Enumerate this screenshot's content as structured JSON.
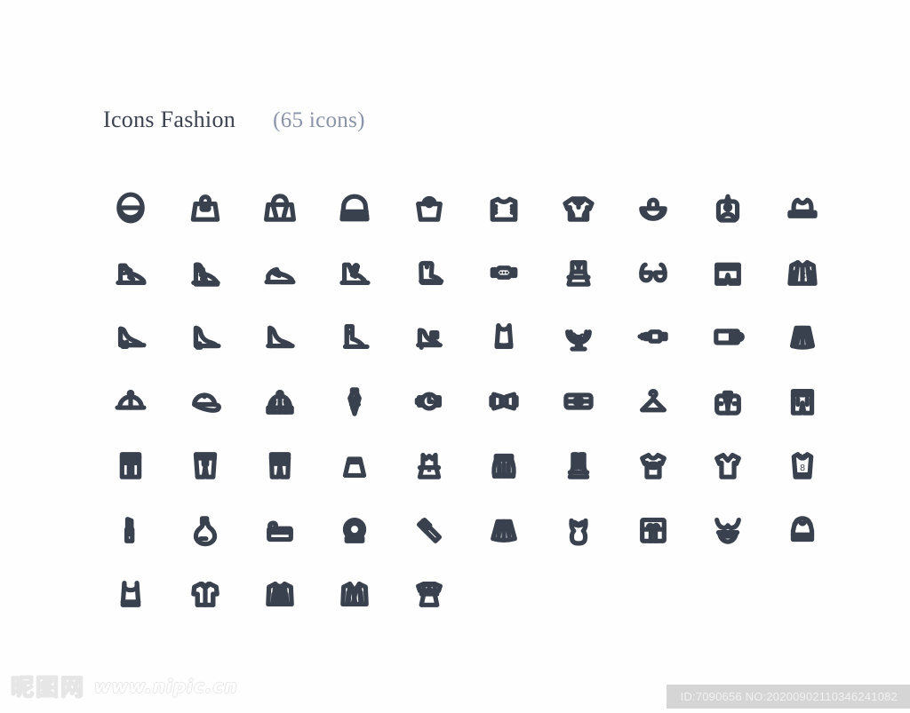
{
  "page": {
    "background_color": "#fefefe",
    "icon_color": "#3a414e",
    "title_color": "#3c4250",
    "count_color": "#8a93a8"
  },
  "header": {
    "title": "Icons Fashion",
    "count_label": "(65 icons)"
  },
  "grid": {
    "columns": 10,
    "rows": 7,
    "total_icons": 65,
    "icons": [
      {
        "name": "coin-purse-icon",
        "label": "Coin purse"
      },
      {
        "name": "handbag-icon",
        "label": "Handbag"
      },
      {
        "name": "tote-bag-icon",
        "label": "Tote bag"
      },
      {
        "name": "doctor-bag-icon",
        "label": "Doctor bag"
      },
      {
        "name": "shopping-bag-icon",
        "label": "Shopping bag"
      },
      {
        "name": "sweater-icon",
        "label": "Sweater"
      },
      {
        "name": "hoodie-icon",
        "label": "Hoodie"
      },
      {
        "name": "bonnet-hat-icon",
        "label": "Bonnet hat"
      },
      {
        "name": "backpack-small-icon",
        "label": "Backpack"
      },
      {
        "name": "fedora-hat-icon",
        "label": "Fedora hat"
      },
      {
        "name": "sneaker-icon",
        "label": "Sneaker"
      },
      {
        "name": "high-top-shoe-icon",
        "label": "High-top shoe"
      },
      {
        "name": "running-shoe-icon",
        "label": "Running shoe"
      },
      {
        "name": "hiking-boot-icon",
        "label": "Hiking boot"
      },
      {
        "name": "rain-boot-icon",
        "label": "Rain boot"
      },
      {
        "name": "wristwatch-dots-icon",
        "label": "Wristwatch"
      },
      {
        "name": "pinafore-dress-icon",
        "label": "Pinafore dress"
      },
      {
        "name": "eyeglasses-icon",
        "label": "Eyeglasses"
      },
      {
        "name": "sport-shorts-icon",
        "label": "Sport shorts"
      },
      {
        "name": "blazer-jacket-icon",
        "label": "Blazer jacket"
      },
      {
        "name": "high-heel-icon",
        "label": "High heel"
      },
      {
        "name": "stiletto-icon",
        "label": "Stiletto"
      },
      {
        "name": "wedge-shoe-icon",
        "label": "Wedge shoe"
      },
      {
        "name": "ankle-boot-icon",
        "label": "Ankle boot"
      },
      {
        "name": "heeled-sandal-icon",
        "label": "Heeled sandal"
      },
      {
        "name": "camisole-icon",
        "label": "Camisole"
      },
      {
        "name": "necklace-icon",
        "label": "Necklace"
      },
      {
        "name": "belt-icon",
        "label": "Belt"
      },
      {
        "name": "wallet-icon",
        "label": "Wallet"
      },
      {
        "name": "a-line-skirt-icon",
        "label": "A-line skirt"
      },
      {
        "name": "flat-cap-icon",
        "label": "Flat cap"
      },
      {
        "name": "baseball-cap-icon",
        "label": "Baseball cap"
      },
      {
        "name": "beanie-icon",
        "label": "Beanie"
      },
      {
        "name": "necktie-icon",
        "label": "Necktie"
      },
      {
        "name": "watch-icon",
        "label": "Watch"
      },
      {
        "name": "bow-tie-icon",
        "label": "Bow tie"
      },
      {
        "name": "clutch-bag-icon",
        "label": "Clutch bag"
      },
      {
        "name": "clothes-hanger-icon",
        "label": "Clothes hanger"
      },
      {
        "name": "backpack-icon",
        "label": "Backpack"
      },
      {
        "name": "cargo-shorts-icon",
        "label": "Cargo shorts"
      },
      {
        "name": "trousers-icon",
        "label": "Trousers"
      },
      {
        "name": "denim-shorts-icon",
        "label": "Denim shorts"
      },
      {
        "name": "jeans-icon",
        "label": "Jeans"
      },
      {
        "name": "mini-skirt-icon",
        "label": "Mini skirt"
      },
      {
        "name": "sundress-icon",
        "label": "Sundress"
      },
      {
        "name": "pleated-skirt-icon",
        "label": "Pleated skirt"
      },
      {
        "name": "overalls-icon",
        "label": "Overalls"
      },
      {
        "name": "tshirt-pocket-icon",
        "label": "T-shirt"
      },
      {
        "name": "v-neck-tshirt-icon",
        "label": "V-neck t-shirt"
      },
      {
        "name": "jersey-number-icon",
        "label": "Sport jersey number 8"
      },
      {
        "name": "lipstick-icon",
        "label": "Lipstick"
      },
      {
        "name": "perfume-bottle-icon",
        "label": "Perfume bottle"
      },
      {
        "name": "cosmetic-pouch-icon",
        "label": "Cosmetic pouch"
      },
      {
        "name": "ring-icon",
        "label": "Ring"
      },
      {
        "name": "makeup-brush-icon",
        "label": "Makeup brush"
      },
      {
        "name": "flared-skirt-icon",
        "label": "Flared skirt"
      },
      {
        "name": "corset-icon",
        "label": "Corset"
      },
      {
        "name": "gift-box-heart-icon",
        "label": "Gift box"
      },
      {
        "name": "bikini-icon",
        "label": "Bikini"
      },
      {
        "name": "crop-top-icon",
        "label": "Crop top"
      },
      {
        "name": "tank-top-icon",
        "label": "Tank top"
      },
      {
        "name": "polo-shirt-icon",
        "label": "Polo shirt"
      },
      {
        "name": "suit-tie-icon",
        "label": "Suit with tie"
      },
      {
        "name": "suit-jacket-icon",
        "label": "Suit jacket"
      },
      {
        "name": "blouse-dress-icon",
        "label": "Blouse dress"
      }
    ]
  },
  "watermark": {
    "site_cn": "昵图网",
    "site_url": "www.nipic.cn",
    "id_text": "ID:7090656 NO:20200902110346241082"
  }
}
